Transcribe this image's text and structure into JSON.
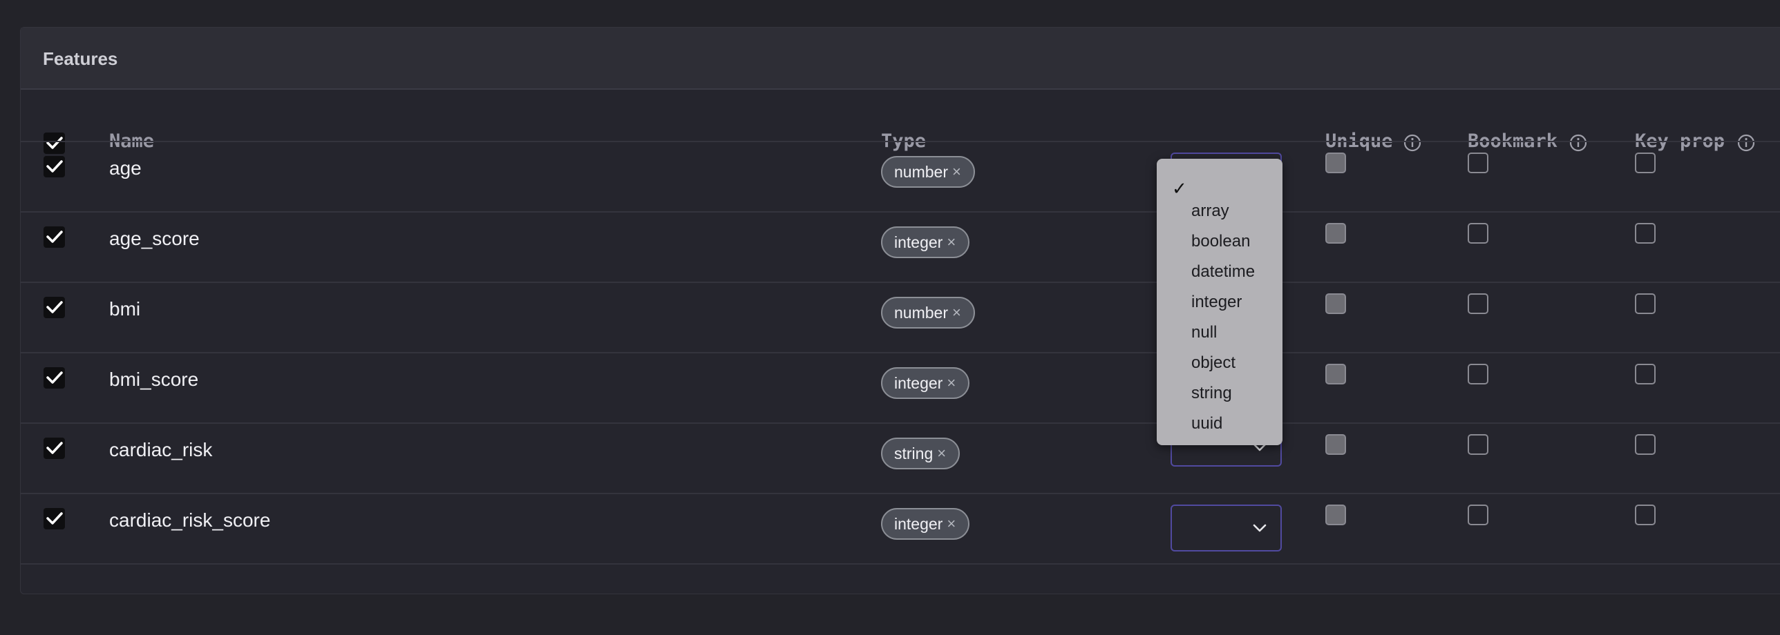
{
  "panel": {
    "title": "Features"
  },
  "columns": {
    "name": "Name",
    "type": "Type",
    "unique": "Unique",
    "bookmark": "Bookmark",
    "key_prop": "Key prop"
  },
  "rows": [
    {
      "name": "age",
      "type": "number",
      "selected": true,
      "unique": false,
      "bookmark": false,
      "key_prop": false
    },
    {
      "name": "age_score",
      "type": "integer",
      "selected": true,
      "unique": false,
      "bookmark": false,
      "key_prop": false
    },
    {
      "name": "bmi",
      "type": "number",
      "selected": true,
      "unique": false,
      "bookmark": false,
      "key_prop": false
    },
    {
      "name": "bmi_score",
      "type": "integer",
      "selected": true,
      "unique": false,
      "bookmark": false,
      "key_prop": false
    },
    {
      "name": "cardiac_risk",
      "type": "string",
      "selected": true,
      "unique": false,
      "bookmark": false,
      "key_prop": false
    },
    {
      "name": "cardiac_risk_score",
      "type": "integer",
      "selected": true,
      "unique": false,
      "bookmark": false,
      "key_prop": false
    }
  ],
  "tag_remove_glyph": "×",
  "dropdown": {
    "selected_mark": "✓",
    "options": [
      "array",
      "boolean",
      "datetime",
      "integer",
      "null",
      "object",
      "string",
      "uuid"
    ]
  },
  "colors": {
    "accent_border": "#514aa0",
    "background": "#232329",
    "panel": "#25252d"
  },
  "icons": {
    "check": "check-icon",
    "info": "info-icon",
    "chevron": "chevron-down-icon",
    "remove": "close-icon"
  }
}
